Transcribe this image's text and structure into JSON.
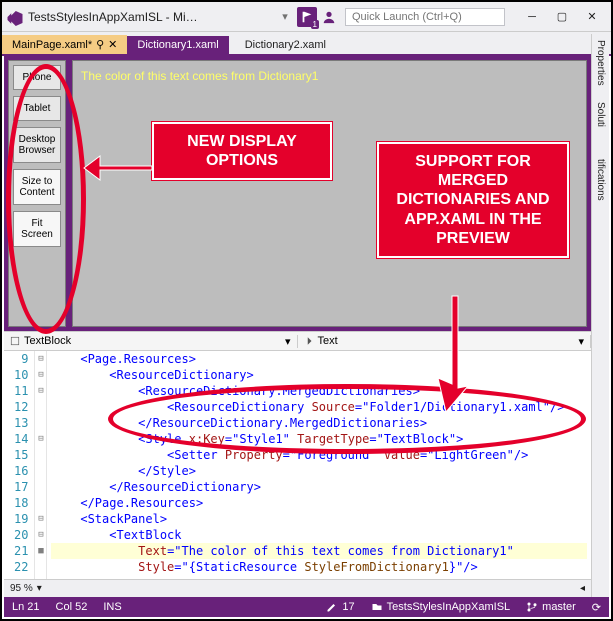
{
  "window": {
    "title": "TestsStylesInAppXamISL - Micr..."
  },
  "flag_badge": "1",
  "quick_launch_placeholder": "Quick Launch (Ctrl+Q)",
  "tabs": [
    {
      "label": "MainPage.xaml*",
      "active": true
    },
    {
      "label": "Dictionary1.xaml",
      "active": false
    },
    {
      "label": "Dictionary2.xaml",
      "active": false
    }
  ],
  "right_tabs": [
    "Properties",
    "Soluti",
    "",
    "tifications"
  ],
  "device_buttons": [
    "Phone",
    "Tablet",
    "Desktop Browser",
    "Size to Content",
    "Fit Screen"
  ],
  "preview_text": "The color of this text comes from Dictionary1",
  "propbar": {
    "left": "TextBlock",
    "right": "Text"
  },
  "code_lines": [
    {
      "n": 9,
      "ind": 1,
      "html": "<span class='t-blue'>&lt;Page.Resources&gt;</span>"
    },
    {
      "n": 10,
      "ind": 2,
      "html": "<span class='t-blue'>&lt;ResourceDictionary&gt;</span>"
    },
    {
      "n": 11,
      "ind": 3,
      "html": "<span class='t-blue'>&lt;ResourceDictionary.MergedDictionaries&gt;</span>"
    },
    {
      "n": 12,
      "ind": 4,
      "html": "<span class='t-blue'>&lt;ResourceDictionary</span> <span class='t-red'>Source</span><span class='t-blue'>=\"Folder1/Dictionary1.xaml\"/&gt;</span>"
    },
    {
      "n": 13,
      "ind": 3,
      "html": "<span class='t-blue'>&lt;/ResourceDictionary.MergedDictionaries&gt;</span>"
    },
    {
      "n": 14,
      "ind": 3,
      "html": "<span class='t-blue'>&lt;Style</span> <span class='t-red'>x:Key</span><span class='t-blue'>=\"Style1\"</span> <span class='t-red'>TargetType</span><span class='t-blue'>=\"TextBlock\"&gt;</span>"
    },
    {
      "n": 15,
      "ind": 4,
      "html": "<span class='t-blue'>&lt;Setter</span> <span class='t-red'>Property</span><span class='t-blue'>=\"Foreground\"</span> <span class='t-red'>Value</span><span class='t-blue'>=\"LightGreen\"/&gt;</span>"
    },
    {
      "n": 16,
      "ind": 3,
      "html": "<span class='t-blue'>&lt;/Style&gt;</span>"
    },
    {
      "n": 17,
      "ind": 2,
      "html": "<span class='t-blue'>&lt;/ResourceDictionary&gt;</span>"
    },
    {
      "n": 18,
      "ind": 1,
      "html": "<span class='t-blue'>&lt;/Page.Resources&gt;</span>"
    },
    {
      "n": 19,
      "ind": 1,
      "html": "<span class='t-blue'>&lt;StackPanel&gt;</span>"
    },
    {
      "n": 20,
      "ind": 2,
      "html": "<span class='t-blue'>&lt;TextBlock</span>"
    },
    {
      "n": 21,
      "ind": 3,
      "hl": true,
      "html": "<span class='t-red'>Text</span><span class='t-blue'>=\"The color of this text comes from Dictionary1\"</span>"
    },
    {
      "n": 22,
      "ind": 3,
      "html": "<span class='t-red'>Style</span><span class='t-blue'>=\"{StaticResource</span> <span class='t-brown'>StyleFromDictionary1</span><span class='t-blue'>}\"/&gt;</span>"
    }
  ],
  "zoom": "95 %",
  "status": {
    "ln": "Ln 21",
    "col": "Col 52",
    "ins": "INS",
    "changes": "17",
    "project": "TestsStylesInAppXamISL",
    "branch": "master"
  },
  "annotations": {
    "box1": "NEW DISPLAY OPTIONS",
    "box2": "SUPPORT FOR MERGED DICTIONARIES AND APP.XAML IN THE PREVIEW"
  }
}
